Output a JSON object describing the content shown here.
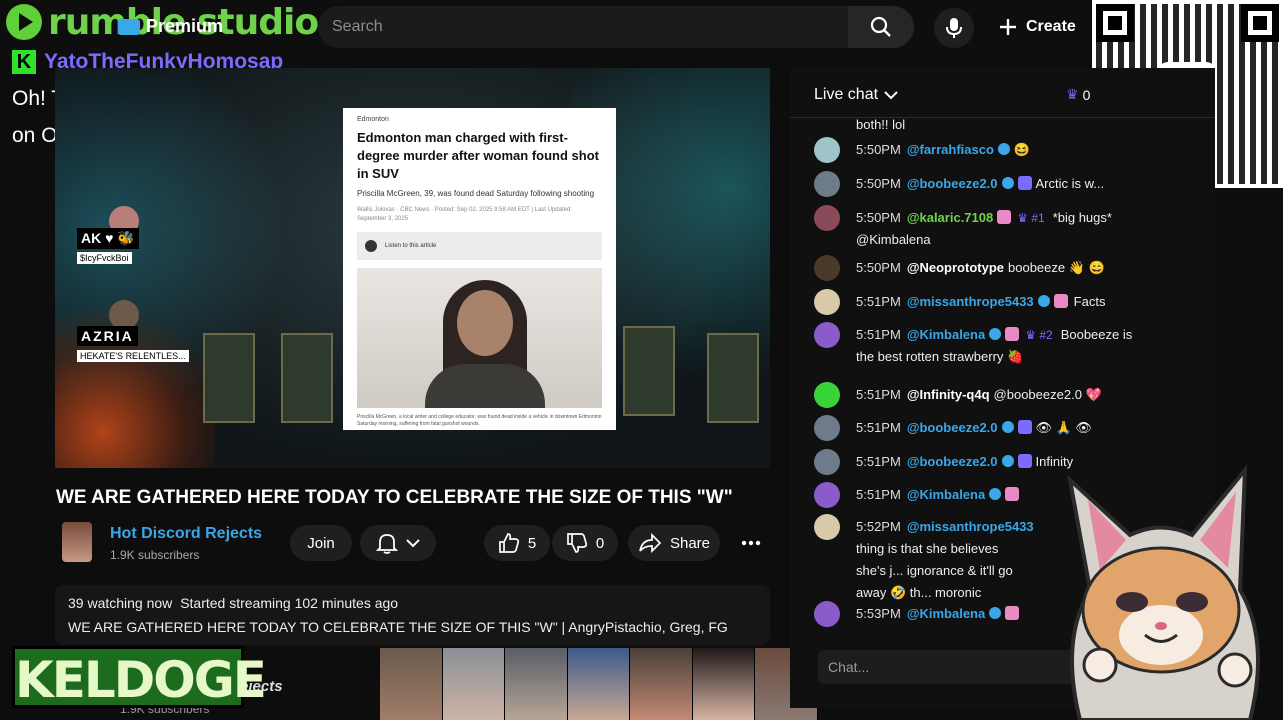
{
  "topbar": {
    "logo_text": "rumble studio",
    "premium_label": "Premium",
    "search_placeholder": "Search",
    "create_label": "Create"
  },
  "overlay": {
    "chat_user": "YatoTheFunkyHomosap",
    "chat_message": "Oh! Turn the volume down on OBS",
    "banner_text": "KELDOGE",
    "donation_icon": "cash-app-icon"
  },
  "video": {
    "participants": [
      {
        "tag": "AK ♥ 🐝",
        "sub": "$IcyFvckBoi"
      },
      {
        "tag": "AZRIA",
        "sub": "HEKATE'S RELENTLES..."
      }
    ],
    "article": {
      "kicker": "Edmonton",
      "headline": "Edmonton man charged with first-degree murder after woman found shot in SUV",
      "deck": "Priscilla McGreen, 39, was found dead Saturday following shooting",
      "meta": "Wallis Jolovac · CBC News · Posted: Sep 02, 2025 9:58 AM EDT | Last Updated: September 3, 2025",
      "listen": "Listen to this article",
      "caption": "Priscilla McGreen, a local writer and college educator, was found dead inside a vehicle in downtown Edmonton Saturday morning, suffering from fatal gunshot wounds."
    }
  },
  "title": "WE ARE GATHERED HERE TODAY TO CELEBRATE THE SIZE OF THIS \"W\"",
  "channel": {
    "name": "Hot Discord Rejects",
    "subscribers": "1.9K subscribers",
    "join_label": "Join",
    "likes": "5",
    "dislikes": "0",
    "share_label": "Share"
  },
  "description": {
    "watching": "39 watching now",
    "started": "Started streaming 102 minutes ago",
    "line2": "WE ARE GATHERED HERE TODAY TO CELEBRATE THE SIZE OF THIS \"W\" | AngryPistachio, Greg, FG"
  },
  "bottom": {
    "channel_fragment": "ejects",
    "subs_fragment": "1.9K subscribers"
  },
  "chat": {
    "title": "Live chat",
    "viewer_count": "0",
    "input_placeholder": "Chat...",
    "messages": [
      {
        "time": "",
        "user": "",
        "text": "both!! lol",
        "av": "#6b5a8a"
      },
      {
        "time": "5:50PM",
        "user": "@farrahfiasco",
        "text": "😆",
        "av": "#9ec3c9"
      },
      {
        "time": "5:50PM",
        "user": "@boobeeze2.0",
        "text": "Arctic is w...",
        "av": "#6d7b8a"
      },
      {
        "time": "5:50PM",
        "user": "@kalaric.7108",
        "rank": "#1",
        "text": "*big hugs*",
        "cont": "@Kimbalena",
        "av": "#8a4a5a"
      },
      {
        "time": "5:50PM",
        "user": "@Neoprototype",
        "text": "boobeeze 👋 😄",
        "av": "#4a3a2a"
      },
      {
        "time": "5:51PM",
        "user": "@missanthrope5433",
        "text": "Facts",
        "av": "#d8c9a8"
      },
      {
        "time": "5:51PM",
        "user": "@Kimbalena",
        "rank": "#2",
        "text": "Boobeeze is",
        "cont": "the best rotten strawberry 🍓",
        "av": "#8a5cc9"
      },
      {
        "time": "5:51PM",
        "user": "@Infinity-q4q",
        "text": "@boobeeze2.0 💖",
        "av": "#39d43a"
      },
      {
        "time": "5:51PM",
        "user": "@boobeeze2.0",
        "text": "👁 🙏 👁",
        "av": "#6d7b8a"
      },
      {
        "time": "5:51PM",
        "user": "@boobeeze2.0",
        "text": "Infinity",
        "av": "#6d7b8a"
      },
      {
        "time": "5:51PM",
        "user": "@Kimbalena",
        "text": "",
        "av": "#8a5cc9"
      },
      {
        "time": "5:52PM",
        "user": "@missanthrope5433",
        "text": "",
        "cont": "thing is that she believes she's j... ignorance & it'll go away 🤣 th... moronic",
        "av": "#d8c9a8"
      },
      {
        "time": "5:53PM",
        "user": "@Kimbalena",
        "text": "",
        "av": "#8a5cc9"
      }
    ]
  },
  "colors": {
    "accent_blue": "#3aa7e8",
    "rumble_green": "#6fd24a",
    "purple": "#7b6cff"
  }
}
